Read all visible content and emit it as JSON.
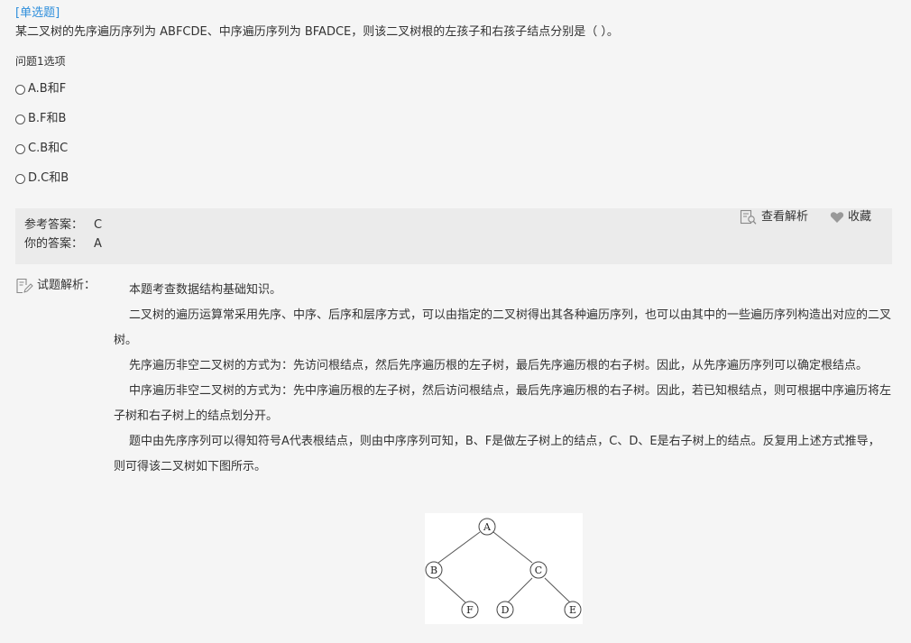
{
  "question": {
    "type_label": "[单选题]",
    "stem": "某二叉树的先序遍历序列为 ABFCDE、中序遍历序列为 BFADCE，则该二叉树根的左孩子和右孩子结点分别是（ ）。",
    "options_label": "问题1选项",
    "options": [
      {
        "label": "A.B和F"
      },
      {
        "label": "B.F和B"
      },
      {
        "label": "C.B和C"
      },
      {
        "label": "D.C和B"
      }
    ]
  },
  "answer": {
    "reference_label": "参考答案：",
    "reference_value": "C",
    "your_label": "你的答案：",
    "your_value": "A",
    "view_analysis_label": "查看解析",
    "favorite_label": "收藏"
  },
  "analysis": {
    "heading": "试题解析：",
    "paragraphs": [
      "本题考查数据结构基础知识。",
      "二叉树的遍历运算常采用先序、中序、后序和层序方式，可以由指定的二叉树得出其各种遍历序列，也可以由其中的一些遍历序列构造出对应的二叉树。",
      "先序遍历非空二叉树的方式为：先访问根结点，然后先序遍历根的左子树，最后先序遍历根的右子树。因此，从先序遍历序列可以确定根结点。",
      "中序遍历非空二叉树的方式为：先中序遍历根的左子树，然后访问根结点，最后先序遍历根的右子树。因此，若已知根结点，则可根据中序遍历将左子树和右子树上的结点划分开。",
      "题中由先序序列可以得知符号A代表根结点，则由中序序列可知，B、F是做左子树上的结点，C、D、E是右子树上的结点。反复用上述方式推导，则可得该二叉树如下图所示。"
    ],
    "tree_nodes": {
      "a": "A",
      "b": "B",
      "c": "C",
      "f": "F",
      "d": "D",
      "e": "E"
    }
  },
  "colors": {
    "accent": "#2f8fdc",
    "background": "#f5f5f5",
    "answer_box": "#ebebeb"
  }
}
